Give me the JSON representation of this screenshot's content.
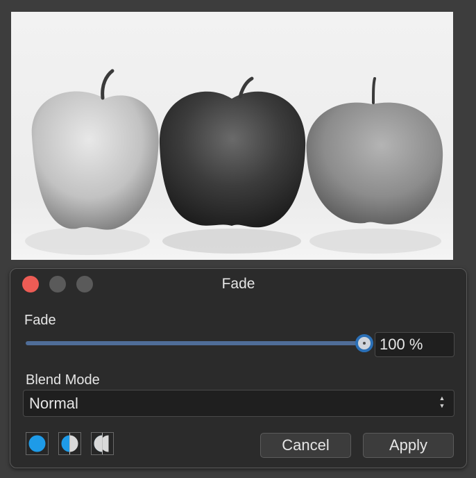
{
  "preview": {
    "icon": "apples-photo"
  },
  "window": {
    "title": "Fade"
  },
  "fade": {
    "label": "Fade",
    "value": 1.0,
    "value_text": "100 %"
  },
  "blend": {
    "label": "Blend Mode",
    "selected": "Normal"
  },
  "mode_buttons": [
    {
      "icon": "full-circle-icon",
      "selected": true
    },
    {
      "icon": "split-circle-icon",
      "selected": false
    },
    {
      "icon": "mirrored-split-circle-icon",
      "selected": false
    }
  ],
  "actions": {
    "cancel": "Cancel",
    "apply": "Apply"
  },
  "colors": {
    "accent": "#2a6fb6",
    "slider_fill": "#4f6d98",
    "close": "#ed5c55",
    "mode_icon": "#1e9be8"
  }
}
